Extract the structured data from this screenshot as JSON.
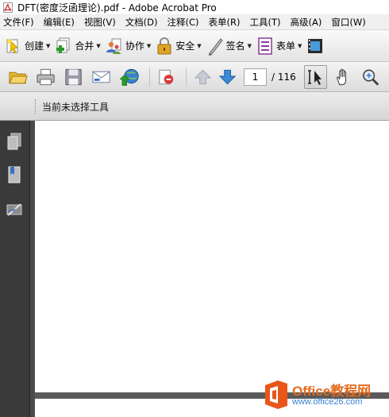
{
  "window": {
    "title": "DFT(密度泛函理论).pdf - Adobe Acrobat Pro"
  },
  "menu": [
    "文件(F)",
    "编辑(E)",
    "视图(V)",
    "文档(D)",
    "注释(C)",
    "表单(R)",
    "工具(T)",
    "高级(A)",
    "窗口(W)"
  ],
  "toolbar_tasks": {
    "create": "创建",
    "combine": "合并",
    "collaborate": "协作",
    "secure": "安全",
    "sign": "签名",
    "forms": "表单"
  },
  "navigation": {
    "current_page": "1",
    "total_pages": "/ 116"
  },
  "status_bar": {
    "text": "当前未选择工具"
  },
  "watermark": {
    "brand": "Office教程网",
    "url": "www.office26.com"
  },
  "colors": {
    "acrobat_red": "#c8141e",
    "watermark_orange": "#e56a1c",
    "watermark_blue": "#3a7fd0"
  }
}
